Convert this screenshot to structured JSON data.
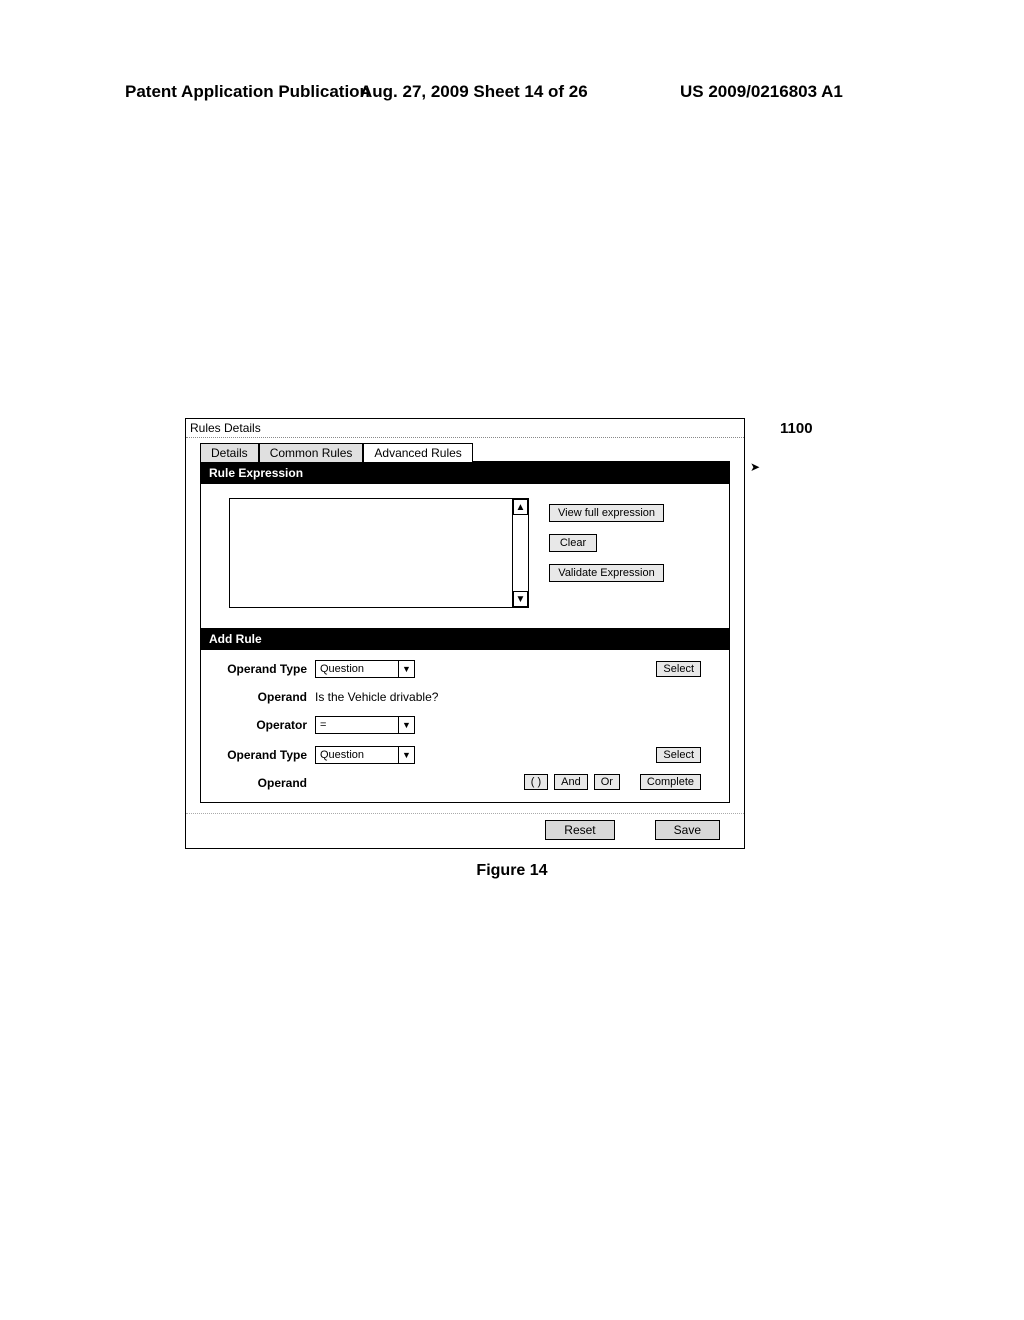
{
  "header": {
    "left": "Patent Application Publication",
    "center": "Aug. 27, 2009  Sheet 14 of 26",
    "right": "US 2009/0216803 A1"
  },
  "reference_number": "1100",
  "panel": {
    "title": "Rules Details",
    "tabs": [
      "Details",
      "Common Rules",
      "Advanced Rules"
    ],
    "rule_expression": {
      "header": "Rule Expression",
      "buttons": {
        "view_full": "View full expression",
        "clear": "Clear",
        "validate": "Validate Expression"
      }
    },
    "add_rule": {
      "header": "Add Rule",
      "rows": {
        "operand_type_1": {
          "label": "Operand Type",
          "value": "Question",
          "select_button": "Select"
        },
        "operand_1": {
          "label": "Operand",
          "value": "Is the Vehicle drivable?"
        },
        "operator": {
          "label": "Operator",
          "value": "="
        },
        "operand_type_2": {
          "label": "Operand Type",
          "value": "Question",
          "select_button": "Select"
        },
        "operand_2": {
          "label": "Operand"
        }
      },
      "bottom_buttons": {
        "paren": "( )",
        "and": "And",
        "or": "Or",
        "complete": "Complete"
      }
    },
    "footer": {
      "reset": "Reset",
      "save": "Save"
    }
  },
  "figure_caption": "Figure 14"
}
